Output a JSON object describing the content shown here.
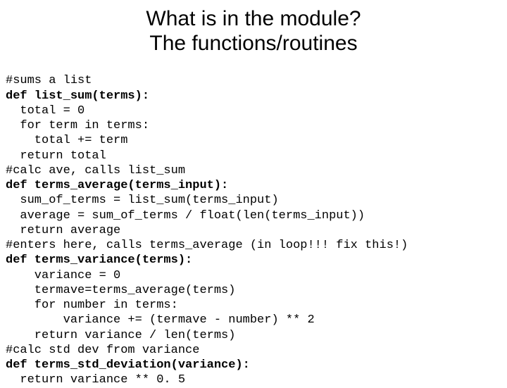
{
  "title_line1": "What is in the module?",
  "title_line2": "The functions/routines",
  "code": {
    "l01": "#sums a list",
    "l02": "def list_sum(terms):",
    "l03": "  total = 0",
    "l04": "  for term in terms:",
    "l05": "    total += term",
    "l06": "  return total",
    "l07": "#calc ave, calls list_sum",
    "l08": "def terms_average(terms_input):",
    "l09": "  sum_of_terms = list_sum(terms_input)",
    "l10": "  average = sum_of_terms / float(len(terms_input))",
    "l11": "  return average",
    "l12": "#enters here, calls terms_average (in loop!!! fix this!)",
    "l13": "def terms_variance(terms):",
    "l14": "    variance = 0",
    "l15": "    termave=terms_average(terms)",
    "l16": "    for number in terms:",
    "l17": "        variance += (termave - number) ** 2",
    "l18": "    return variance / len(terms)",
    "l19": "#calc std dev from variance",
    "l20": "def terms_std_deviation(variance):",
    "l21": "  return variance ** 0. 5"
  }
}
